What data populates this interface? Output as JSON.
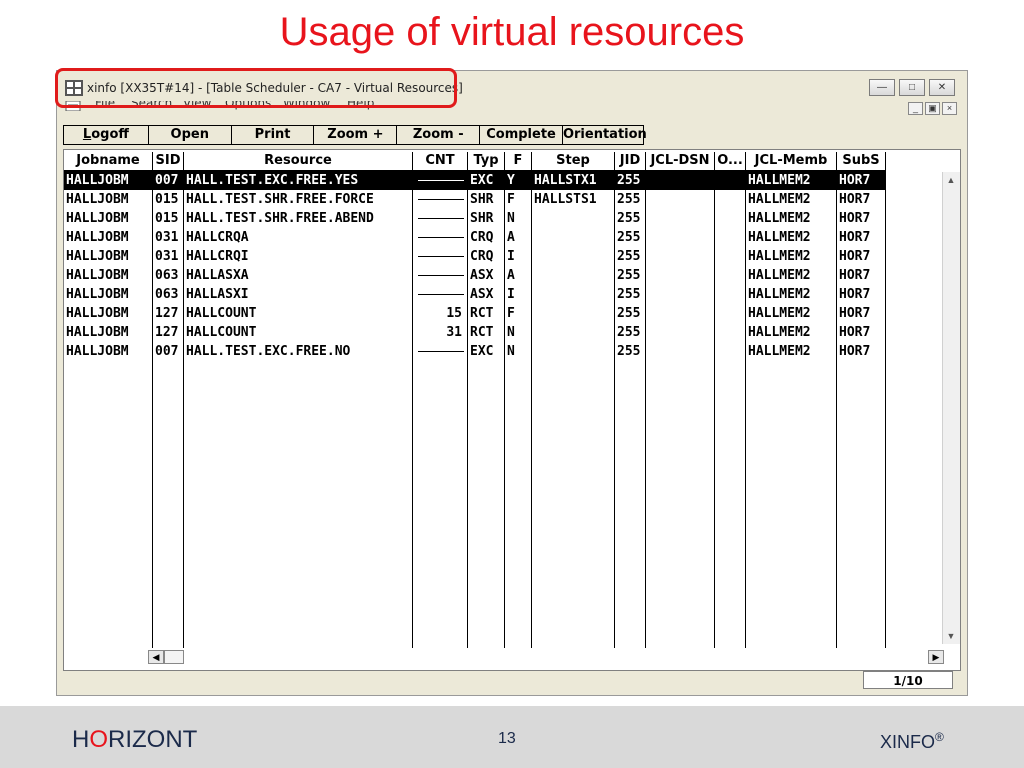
{
  "slide": {
    "title": "Usage of virtual resources",
    "page_number": "13",
    "brand_prefix": "H",
    "brand_o": "O",
    "brand_rest": "RIZONT",
    "product": "XINFO",
    "product_mark": "®"
  },
  "window": {
    "title": "xinfo [XX35T#14] - [Table Scheduler - CA7 - Virtual Resources]",
    "caption_buttons": [
      "minimize-icon",
      "maximize-icon",
      "close-icon"
    ]
  },
  "menu": {
    "items": [
      "File",
      "Search",
      "View",
      "Options",
      "Window",
      "Help"
    ]
  },
  "toolbar": {
    "buttons": [
      "Logoff",
      "Open",
      "Print",
      "Zoom +",
      "Zoom -",
      "Complete",
      "Orientation"
    ]
  },
  "table": {
    "columns": [
      "Jobname",
      "SID",
      "Resource",
      "CNT",
      "Typ",
      "F",
      "Step",
      "JID",
      "JCL-DSN",
      "O...",
      "JCL-Memb",
      "SubS"
    ],
    "rows": [
      {
        "jobname": "HALLJOBM",
        "sid": "007",
        "resource": "HALL.TEST.EXC.FREE.YES",
        "cnt": "",
        "typ": "EXC",
        "f": "Y",
        "step": "HALLSTX1",
        "jid": "255",
        "jcl_dsn": "",
        "o": "",
        "jcl_memb": "HALLMEM2",
        "subs": "HOR7",
        "selected": true
      },
      {
        "jobname": "HALLJOBM",
        "sid": "015",
        "resource": "HALL.TEST.SHR.FREE.FORCE",
        "cnt": "",
        "typ": "SHR",
        "f": "F",
        "step": "HALLSTS1",
        "jid": "255",
        "jcl_dsn": "",
        "o": "",
        "jcl_memb": "HALLMEM2",
        "subs": "HOR7",
        "selected": false
      },
      {
        "jobname": "HALLJOBM",
        "sid": "015",
        "resource": "HALL.TEST.SHR.FREE.ABEND",
        "cnt": "",
        "typ": "SHR",
        "f": "N",
        "step": "",
        "jid": "255",
        "jcl_dsn": "",
        "o": "",
        "jcl_memb": "HALLMEM2",
        "subs": "HOR7",
        "selected": false
      },
      {
        "jobname": "HALLJOBM",
        "sid": "031",
        "resource": "HALLCRQA",
        "cnt": "",
        "typ": "CRQ",
        "f": "A",
        "step": "",
        "jid": "255",
        "jcl_dsn": "",
        "o": "",
        "jcl_memb": "HALLMEM2",
        "subs": "HOR7",
        "selected": false
      },
      {
        "jobname": "HALLJOBM",
        "sid": "031",
        "resource": "HALLCRQI",
        "cnt": "",
        "typ": "CRQ",
        "f": "I",
        "step": "",
        "jid": "255",
        "jcl_dsn": "",
        "o": "",
        "jcl_memb": "HALLMEM2",
        "subs": "HOR7",
        "selected": false
      },
      {
        "jobname": "HALLJOBM",
        "sid": "063",
        "resource": "HALLASXA",
        "cnt": "",
        "typ": "ASX",
        "f": "A",
        "step": "",
        "jid": "255",
        "jcl_dsn": "",
        "o": "",
        "jcl_memb": "HALLMEM2",
        "subs": "HOR7",
        "selected": false
      },
      {
        "jobname": "HALLJOBM",
        "sid": "063",
        "resource": "HALLASXI",
        "cnt": "",
        "typ": "ASX",
        "f": "I",
        "step": "",
        "jid": "255",
        "jcl_dsn": "",
        "o": "",
        "jcl_memb": "HALLMEM2",
        "subs": "HOR7",
        "selected": false
      },
      {
        "jobname": "HALLJOBM",
        "sid": "127",
        "resource": "HALLCOUNT",
        "cnt": "15",
        "typ": "RCT",
        "f": "F",
        "step": "",
        "jid": "255",
        "jcl_dsn": "",
        "o": "",
        "jcl_memb": "HALLMEM2",
        "subs": "HOR7",
        "selected": false
      },
      {
        "jobname": "HALLJOBM",
        "sid": "127",
        "resource": "HALLCOUNT",
        "cnt": "31",
        "typ": "RCT",
        "f": "N",
        "step": "",
        "jid": "255",
        "jcl_dsn": "",
        "o": "",
        "jcl_memb": "HALLMEM2",
        "subs": "HOR7",
        "selected": false
      },
      {
        "jobname": "HALLJOBM",
        "sid": "007",
        "resource": "HALL.TEST.EXC.FREE.NO",
        "cnt": "",
        "typ": "EXC",
        "f": "N",
        "step": "",
        "jid": "255",
        "jcl_dsn": "",
        "o": "",
        "jcl_memb": "HALLMEM2",
        "subs": "HOR7",
        "selected": false
      }
    ]
  },
  "status": {
    "page": "1/10"
  },
  "colors": {
    "title_red": "#e8141c",
    "highlight_box": "#e01b1b",
    "footer_bg": "#d9d9d9",
    "brand_text": "#1b2a4a"
  }
}
